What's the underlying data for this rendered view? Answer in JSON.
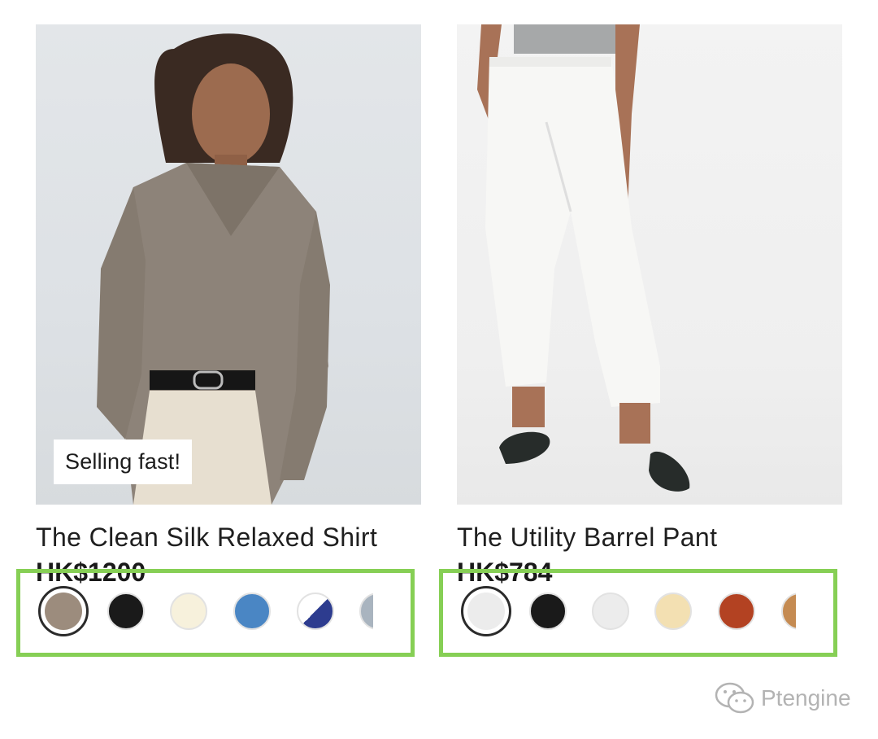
{
  "products": [
    {
      "badge": "Selling fast!",
      "name": "The Clean Silk Relaxed Shirt",
      "price": "HK$1200",
      "swatches": [
        {
          "color": "#9c8c7d",
          "selected": true
        },
        {
          "color": "#1a1a1a",
          "selected": false
        },
        {
          "color": "#f7f1dc",
          "selected": false
        },
        {
          "color": "#4a86c4",
          "selected": false
        },
        {
          "color": "split-navy-white",
          "selected": false
        },
        {
          "color": "#a9b4bf",
          "selected": false
        }
      ]
    },
    {
      "name": "The Utility Barrel Pant",
      "price": "HK$784",
      "swatches": [
        {
          "color": "#ececec",
          "selected": true
        },
        {
          "color": "#1a1a1a",
          "selected": false
        },
        {
          "color": "#ececec",
          "selected": false
        },
        {
          "color": "#f3e0b2",
          "selected": false
        },
        {
          "color": "#b34222",
          "selected": false
        },
        {
          "color": "#c58b52",
          "selected": false
        }
      ]
    }
  ],
  "watermark": {
    "text": "Ptengine",
    "icon": "wechat-icon"
  },
  "highlight_color": "#86cf55"
}
